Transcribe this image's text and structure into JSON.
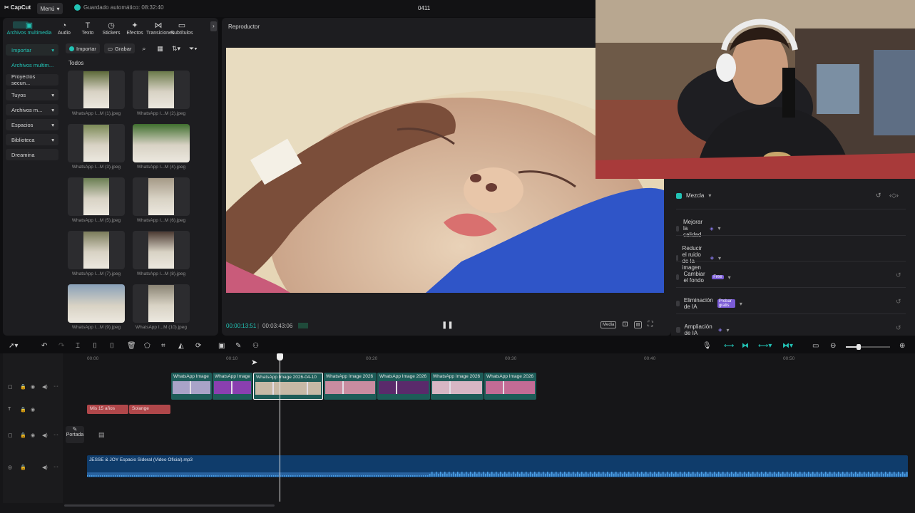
{
  "app": {
    "logo": "CapCut",
    "menu_label": "Menú",
    "autosave": "Guardado automático: 08:32:40",
    "project_title": "0411"
  },
  "tabs": [
    {
      "label": "Archivos multimedia",
      "icon": "media-icon",
      "glyph": "▣",
      "active": true
    },
    {
      "label": "Audio",
      "icon": "audio-icon",
      "glyph": "◔"
    },
    {
      "label": "Texto",
      "icon": "text-icon",
      "glyph": "T"
    },
    {
      "label": "Stickers",
      "icon": "sticker-icon",
      "glyph": "◷"
    },
    {
      "label": "Efectos",
      "icon": "effects-icon",
      "glyph": "✦"
    },
    {
      "label": "Transiciones",
      "icon": "transitions-icon",
      "glyph": "⋈"
    },
    {
      "label": "Subtítulos",
      "icon": "subtitles-icon",
      "glyph": "▭"
    }
  ],
  "sidebar": {
    "items": [
      {
        "label": "Importar",
        "chev": "▾"
      },
      {
        "label": "Archivos multim...",
        "chev": ""
      },
      {
        "label": "Proyectos secun...",
        "chev": ""
      },
      {
        "label": "Tuyos",
        "chev": "▾"
      },
      {
        "label": "Archivos m...",
        "chev": "▾"
      },
      {
        "label": "Espacios",
        "chev": "▾"
      },
      {
        "label": "Biblioteca",
        "chev": "▾"
      },
      {
        "label": "Dreamina",
        "chev": ""
      }
    ]
  },
  "media": {
    "import_label": "Importar",
    "record_label": "Grabar",
    "section_label": "Todos",
    "items": [
      "WhatsApp I...M (1).jpeg",
      "WhatsApp I...M (2).jpeg",
      "WhatsApp I...M (3).jpeg",
      "WhatsApp I...M (4).jpeg",
      "WhatsApp I...M (5).jpeg",
      "WhatsApp I...M (6).jpeg",
      "WhatsApp I...M (7).jpeg",
      "WhatsApp I...M (8).jpeg",
      "WhatsApp I...M (9).jpeg",
      "WhatsApp I...M (10).jpeg"
    ]
  },
  "player": {
    "title": "Reproductor",
    "current_time": "00:00:13:51",
    "total_time": "00:03:43:06",
    "ratio_label": "Media"
  },
  "properties": {
    "items": [
      {
        "label": "Mezcla",
        "checked": true,
        "extra": "",
        "badge": ""
      },
      {
        "label": "Mejorar la calidad",
        "checked": false,
        "extra": "gem",
        "badge": ""
      },
      {
        "label": "Reducir el ruido de la imagen",
        "checked": false,
        "extra": "gem",
        "badge": ""
      },
      {
        "label": "Cambiar el fondo",
        "checked": false,
        "extra": "",
        "badge": "Free"
      },
      {
        "label": "Eliminación de IA",
        "checked": false,
        "extra": "",
        "badge": "Probar gratis"
      },
      {
        "label": "Ampliación de IA",
        "checked": false,
        "extra": "gem",
        "badge": ""
      }
    ]
  },
  "timeline": {
    "ruler": [
      "00:00",
      "00:10",
      "00:20",
      "00:30",
      "00:40",
      "00:50"
    ],
    "clips": [
      "WhatsApp Image",
      "WhatsApp Image",
      "WhatsApp Image 2026-04-10",
      "WhatsApp Image 2026",
      "WhatsApp Image 2026",
      "WhatsApp Image 2026",
      "WhatsApp Image 2026"
    ],
    "text_clips": [
      "Mis 15 años",
      "Solange"
    ],
    "cover_label": "Portada",
    "audio_label": "JESSE & JOY  Espacio Sideral (Video Oficial).mp3"
  }
}
